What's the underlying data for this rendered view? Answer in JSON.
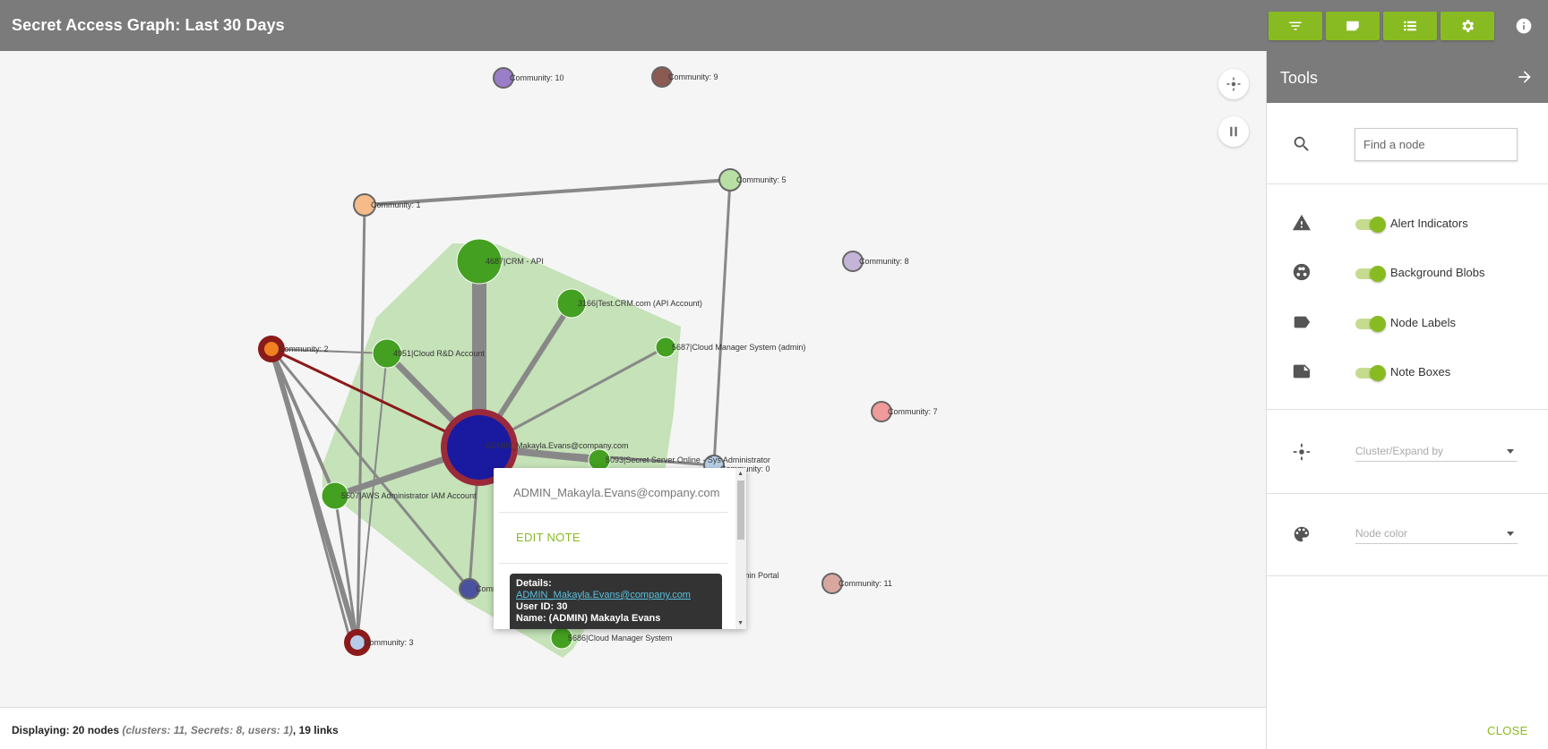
{
  "header": {
    "title": "Secret Access Graph: Last 30 Days",
    "buttons": [
      "filter-icon",
      "note-icon",
      "list-icon",
      "gear-icon"
    ],
    "info_icon": "info-icon"
  },
  "colors": {
    "accent": "#88bb22",
    "header": "#7b7b7b",
    "hull": "#c2e0b4",
    "secret_node": "#44a020",
    "user_node": "#1a1aa0",
    "alert_ring": "#8b1a1a"
  },
  "graph": {
    "community_labels": {
      "c10": "Community: 10",
      "c9": "Community: 9",
      "c5": "Community: 5",
      "c1": "Community: 1",
      "c8": "Community: 8",
      "c2": "Community: 2",
      "c7": "Community: 7",
      "c11": "Community: 11",
      "c3": "Community: 3",
      "c0": "Community: 0"
    },
    "node_labels": {
      "crm_api": "4687|CRM - API",
      "test_crm": "3166|Test.CRM.com (API Account)",
      "cloud_rd": "4951|Cloud R&D Account",
      "cloud_mgr_admin": "5687|Cloud Manager System (admin)",
      "admin_user": "ADMIN_Makayla.Evans@company.com",
      "secret_server": "5093|Secret Server Online - Sys Administrator",
      "aws_admin": "5507|AWS Administrator IAM Account",
      "admin_portal": "Admin Portal",
      "cloud_mgr": "5686|Cloud Manager System",
      "partial_comm": "Comm"
    }
  },
  "popup": {
    "title": "ADMIN_Makayla.Evans@company.com",
    "edit_label": "EDIT NOTE",
    "details_heading": "Details:",
    "details_link": "ADMIN_Makayla.Evans@company.com",
    "user_id": "User ID: 30",
    "name": "Name: (ADMIN) Makayla Evans"
  },
  "footer": {
    "prefix": "Displaying: 20 nodes",
    "detail": "(clusters: 11, Secrets: 8, users: 1)",
    "suffix": ", 19 links"
  },
  "tools": {
    "title": "Tools",
    "search_placeholder": "Find a node",
    "toggles": [
      {
        "label": "Alert Indicators",
        "icon": "warning-icon",
        "on": true
      },
      {
        "label": "Background Blobs",
        "icon": "blobs-icon",
        "on": true
      },
      {
        "label": "Node Labels",
        "icon": "label-icon",
        "on": true
      },
      {
        "label": "Note Boxes",
        "icon": "note-icon",
        "on": true
      }
    ],
    "cluster_placeholder": "Cluster/Expand by",
    "color_placeholder": "Node color",
    "close_label": "CLOSE"
  }
}
